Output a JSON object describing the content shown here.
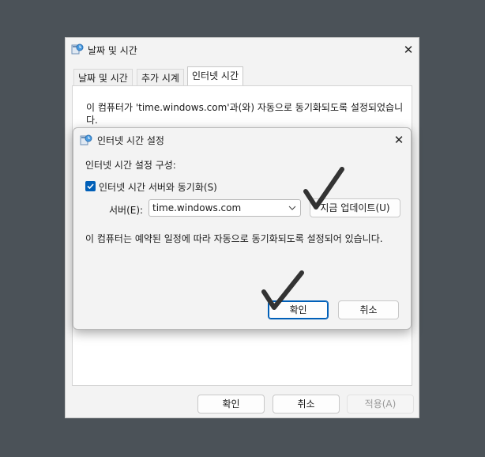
{
  "outer_dialog": {
    "title": "날짜 및 시간",
    "tabs": [
      {
        "label": "날짜 및 시간",
        "active": false
      },
      {
        "label": "추가 시계",
        "active": false
      },
      {
        "label": "인터넷 시간",
        "active": true
      }
    ],
    "description": "이 컴퓨터가 'time.windows.com'과(와) 자동으로 동기화되도록 설정되었습니다.",
    "ok_label": "확인",
    "cancel_label": "취소",
    "apply_label": "적용(A)"
  },
  "inner_dialog": {
    "title": "인터넷 시간 설정",
    "section_label": "인터넷 시간 설정 구성:",
    "sync_checkbox": {
      "label": "인터넷 시간 서버와 동기화(S)",
      "checked": true
    },
    "server_label": "서버(E):",
    "server_value": "time.windows.com",
    "update_now_label": "지금 업데이트(U)",
    "schedule_text": "이 컴퓨터는 예약된 일정에 따라 자동으로 동기화되도록 설정되어 있습니다.",
    "ok_label": "확인",
    "cancel_label": "취소"
  },
  "colors": {
    "backdrop": "#4b5258",
    "accent": "#005fb8",
    "annotation_check": "#333333"
  },
  "icons": [
    "clock-globe-icon",
    "close-icon",
    "chevron-down-icon",
    "checkmark-annotation-icon"
  ]
}
